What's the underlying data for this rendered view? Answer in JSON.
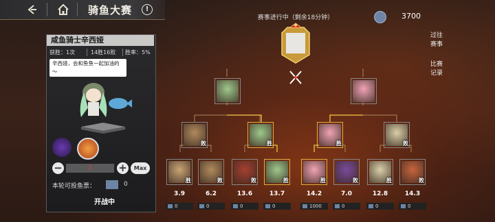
{
  "header": {
    "title": "骑鱼大赛",
    "back_icon": "back-arrow-icon",
    "home_icon": "home-icon",
    "info_label": "!"
  },
  "status": {
    "text": "赛事进行中（剩余18分钟）"
  },
  "currency": {
    "amount": "3700",
    "icon": "fish-ticket-icon"
  },
  "side_buttons": [
    {
      "label": "过往赛事"
    },
    {
      "label": "比赛记录"
    }
  ],
  "panel": {
    "name": "咸鱼骑士辛西娅",
    "wins_label": "获胜：1次",
    "record_label": "14胜16败",
    "winrate_label": "胜率：5%",
    "speech": "辛西娅，会和鱼鱼一起加油的～",
    "bet_value": "1",
    "minus_label": "−",
    "plus_label": "+",
    "max_label": "Max",
    "tickets_label": "本轮可投鱼票：",
    "tickets_value": "0",
    "fight_label": "开战中"
  },
  "bracket": {
    "round1": [
      {
        "result": "胜",
        "odds": "3.9",
        "bet": "0",
        "color": "#c9a474"
      },
      {
        "result": "败",
        "odds": "6.2",
        "bet": "0",
        "color": "#b08a5c"
      },
      {
        "result": "败",
        "odds": "13.6",
        "bet": "0",
        "color": "#a54030"
      },
      {
        "result": "胜",
        "odds": "13.7",
        "bet": "0",
        "color": "#9ec88c"
      },
      {
        "result": "胜",
        "odds": "14.2",
        "bet": "1000",
        "color": "#f0a3b5"
      },
      {
        "result": "败",
        "odds": "7.0",
        "bet": "0",
        "color": "#7a4a9a"
      },
      {
        "result": "胜",
        "odds": "12.8",
        "bet": "0",
        "color": "#d8cfa8"
      },
      {
        "result": "败",
        "odds": "14.3",
        "bet": "0",
        "color": "#c8643c"
      }
    ],
    "round2": [
      {
        "result": "败",
        "color": "#b08a5c"
      },
      {
        "result": "胜",
        "color": "#9ec88c"
      },
      {
        "result": "胜",
        "color": "#f0a3b5"
      },
      {
        "result": "败",
        "color": "#d8cfa8"
      }
    ],
    "round3": [
      {
        "result": "",
        "color": "#9ec88c"
      },
      {
        "result": "",
        "color": "#f0a3b5"
      }
    ]
  }
}
